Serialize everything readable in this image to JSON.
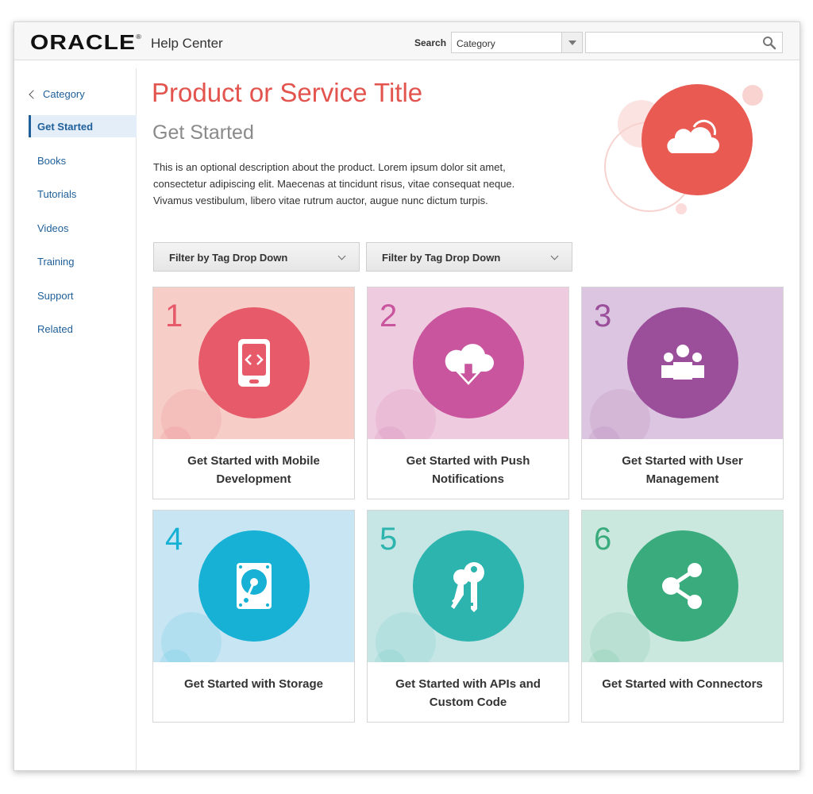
{
  "header": {
    "logo_text": "ORACLE",
    "logo_mark": "®",
    "product_name": "Help Center",
    "search_label": "Search",
    "category_select_value": "Category",
    "search_placeholder": ""
  },
  "sidebar": {
    "back_label": "Category",
    "items": [
      {
        "label": "Get Started",
        "active": true
      },
      {
        "label": "Books",
        "active": false
      },
      {
        "label": "Tutorials",
        "active": false
      },
      {
        "label": "Videos",
        "active": false
      },
      {
        "label": "Training",
        "active": false
      },
      {
        "label": "Support",
        "active": false
      },
      {
        "label": "Related",
        "active": false
      }
    ]
  },
  "main": {
    "title": "Product or Service Title",
    "subtitle": "Get Started",
    "description": "This is an optional description about the product. Lorem ipsum dolor sit amet, consectetur adipiscing elit. Maecenas at tincidunt risus, vitae consequat neque. Vivamus vestibulum, libero vitae rutrum auctor, augue nunc dictum turpis.",
    "hero_icon": "cloud-icon",
    "filters": [
      {
        "label": "Filter by Tag Drop Down"
      },
      {
        "label": "Filter by Tag Drop Down"
      }
    ]
  },
  "cards": [
    {
      "number": "1",
      "label": "Get Started with Mobile Development",
      "icon": "mobile-code-icon",
      "bg": "#f6cdc7",
      "circle": "#e65a6a",
      "num_color": "#e65a6a"
    },
    {
      "number": "2",
      "label": "Get Started with Push Notifications",
      "icon": "cloud-download-icon",
      "bg": "#efcbdf",
      "circle": "#c9559e",
      "num_color": "#c9559e"
    },
    {
      "number": "3",
      "label": "Get Started with User Management",
      "icon": "users-icon",
      "bg": "#dcc5e0",
      "circle": "#9b4f9b",
      "num_color": "#9b4f9b"
    },
    {
      "number": "4",
      "label": "Get Started with Storage",
      "icon": "hard-drive-icon",
      "bg": "#c7e5f3",
      "circle": "#16b1d4",
      "num_color": "#16b1d4"
    },
    {
      "number": "5",
      "label": "Get Started with APIs and Custom Code",
      "icon": "keys-icon",
      "bg": "#c6e6e6",
      "circle": "#2eb4ae",
      "num_color": "#2eb4ae"
    },
    {
      "number": "6",
      "label": "Get Started with Connectors",
      "icon": "share-icon",
      "bg": "#cbe8df",
      "circle": "#3aab7c",
      "num_color": "#3aab7c"
    }
  ],
  "colors": {
    "title": "#e2544d",
    "link": "#1f5f99",
    "hero": "#e85a52"
  }
}
